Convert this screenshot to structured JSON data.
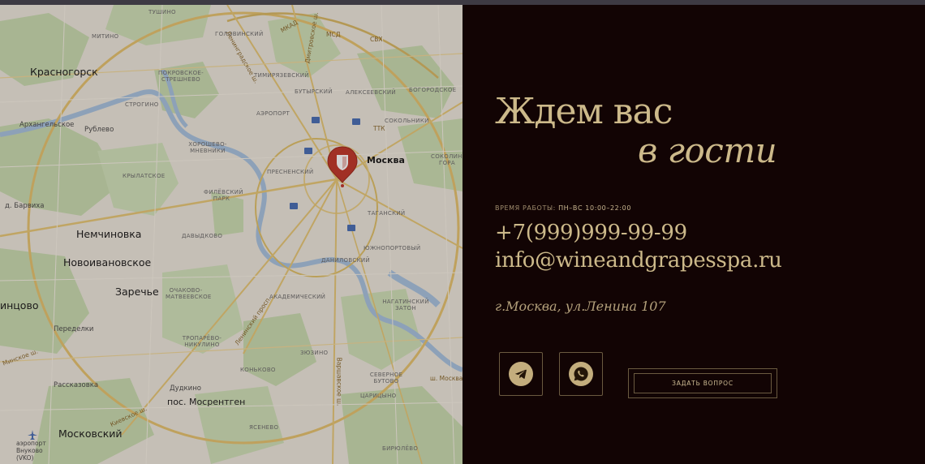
{
  "map": {
    "city_labels": [
      {
        "text": "Красногорск"
      },
      {
        "text": "Архангельское"
      },
      {
        "text": "Рублево"
      },
      {
        "text": "д. Барвиха"
      },
      {
        "text": "Немчиновка"
      },
      {
        "text": "Новоивановское"
      },
      {
        "text": "Заречье"
      },
      {
        "text": "инцово"
      },
      {
        "text": "Переделки"
      },
      {
        "text": "Рассказовка"
      },
      {
        "text": "Дудкино"
      },
      {
        "text": "пос. Мосрентген"
      },
      {
        "text": "Московский"
      },
      {
        "text": "аэропорт Внуково (VKO)"
      },
      {
        "text": "Москва"
      }
    ],
    "district_labels": [
      {
        "text": "ТУШИНО"
      },
      {
        "text": "МИТИНО"
      },
      {
        "text": "ГОЛОВИНСКИЙ"
      },
      {
        "text": "ТИМИРЯЗЕВСКИЙ"
      },
      {
        "text": "ПОКРОВСКОЕ-СТРЕШНЕВО"
      },
      {
        "text": "СТРОГИНО"
      },
      {
        "text": "ХОРОШЕВО-МНЕВНИКИ"
      },
      {
        "text": "КРЫЛАТСКОЕ"
      },
      {
        "text": "ФИЛЁВСКИЙ ПАРК"
      },
      {
        "text": "ПРЕСНЕНСКИЙ"
      },
      {
        "text": "ДАВЫДКОВО"
      },
      {
        "text": "ОЧАКОВО-МАТВЕЕВСКОЕ"
      },
      {
        "text": "ТРОПАРЁВО-НИКУЛИНО"
      },
      {
        "text": "КОНЬКОВО"
      },
      {
        "text": "ЯСЕНЕВО"
      },
      {
        "text": "ЗЮЗИНО"
      },
      {
        "text": "ДАНИЛОВСКИЙ"
      },
      {
        "text": "ТАГАНСКИЙ"
      },
      {
        "text": "ЮЖНОПОРТОВЫЙ"
      },
      {
        "text": "АЛЕКСЕЕВСКИЙ"
      },
      {
        "text": "БУТЫРСКИЙ"
      },
      {
        "text": "СОКОЛЬНИКИ"
      },
      {
        "text": "БОГОРОДСКОЕ"
      },
      {
        "text": "СОКОЛИНАЯ ГОРА"
      },
      {
        "text": "НАГАТИНСКИЙ ЗАТОН"
      },
      {
        "text": "СЕВЕРНОЕ БУТОВО"
      },
      {
        "text": "ЦАРИЦЫНО"
      },
      {
        "text": "БИРЮЛЁВО"
      },
      {
        "text": "АКАДЕМИЧЕСКИЙ"
      },
      {
        "text": "АЭРОПОРТ"
      }
    ],
    "road_labels": [
      {
        "text": "МКАД"
      },
      {
        "text": "МСД"
      },
      {
        "text": "СВХ"
      },
      {
        "text": "ТТК"
      },
      {
        "text": "Ленинградское ш."
      },
      {
        "text": "Ленинский просп."
      },
      {
        "text": "Киевское ш."
      },
      {
        "text": "Минское ш."
      },
      {
        "text": "Варшавское ш."
      },
      {
        "text": "Дмитровское ш."
      },
      {
        "text": "ш. Москва"
      }
    ],
    "colors": {
      "marker": "#c0392b",
      "water": "#a8c3df",
      "park": "#c8dbb0"
    }
  },
  "panel": {
    "title_line1": "Ждем вас",
    "title_line2": "в гости",
    "hours_label": "ВРЕМЯ РАБОТЫ:",
    "hours_value": "ПН–ВС 10:00–22:00",
    "phone": "+7(999)999-99-99",
    "email": "info@wineandgrapesspa.ru",
    "address": "г.Москва, ул.Ленина 107",
    "social": [
      {
        "name": "telegram",
        "icon": "telegram-icon"
      },
      {
        "name": "whatsapp",
        "icon": "whatsapp-icon"
      }
    ],
    "ask_button": "ЗАДАТЬ ВОПРОС",
    "colors": {
      "background": "#120404",
      "accent": "#ccb98a"
    }
  }
}
